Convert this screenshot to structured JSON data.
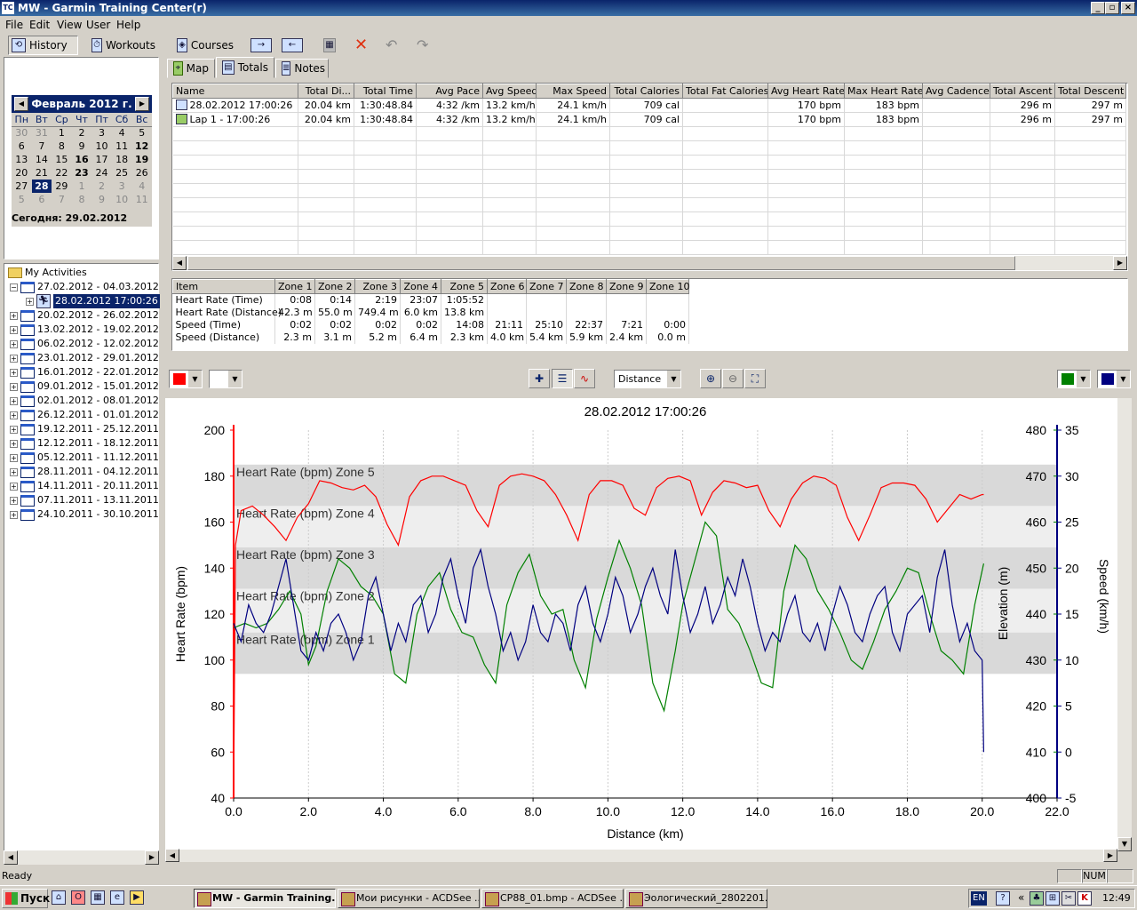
{
  "window": {
    "title": "MW - Garmin Training Center(r)",
    "app_icon_text": "TC",
    "minimize": "_",
    "maximize": "▫",
    "close": "×"
  },
  "menu": [
    "File",
    "Edit",
    "View",
    "User",
    "Help"
  ],
  "toolbar": {
    "history": "History",
    "workouts": "Workouts",
    "courses": "Courses"
  },
  "calendar": {
    "month_title": "Февраль 2012 г.",
    "prev": "◀",
    "next": "▶",
    "weekdays": [
      "Пн",
      "Вт",
      "Ср",
      "Чт",
      "Пт",
      "Сб",
      "Вс"
    ],
    "weeks": [
      [
        "30",
        "31",
        "1",
        "2",
        "3",
        "4",
        "5"
      ],
      [
        "6",
        "7",
        "8",
        "9",
        "10",
        "11",
        "12"
      ],
      [
        "13",
        "14",
        "15",
        "16",
        "17",
        "18",
        "19"
      ],
      [
        "20",
        "21",
        "22",
        "23",
        "24",
        "25",
        "26"
      ],
      [
        "27",
        "28",
        "29",
        "1",
        "2",
        "3",
        "4"
      ],
      [
        "5",
        "6",
        "7",
        "8",
        "9",
        "10",
        "11"
      ]
    ],
    "today_label": "Сегодня: 29.02.2012"
  },
  "tree": {
    "root": "My Activities",
    "items": [
      {
        "label": "27.02.2012 - 04.03.2012",
        "expanded": true
      },
      {
        "label": "28.02.2012 17:00:26",
        "child": true,
        "selected": true
      },
      {
        "label": "20.02.2012 - 26.02.2012"
      },
      {
        "label": "13.02.2012 - 19.02.2012"
      },
      {
        "label": "06.02.2012 - 12.02.2012"
      },
      {
        "label": "23.01.2012 - 29.01.2012"
      },
      {
        "label": "16.01.2012 - 22.01.2012"
      },
      {
        "label": "09.01.2012 - 15.01.2012"
      },
      {
        "label": "02.01.2012 - 08.01.2012"
      },
      {
        "label": "26.12.2011 - 01.01.2012"
      },
      {
        "label": "19.12.2011 - 25.12.2011"
      },
      {
        "label": "12.12.2011 - 18.12.2011"
      },
      {
        "label": "05.12.2011 - 11.12.2011"
      },
      {
        "label": "28.11.2011 - 04.12.2011"
      },
      {
        "label": "14.11.2011 - 20.11.2011"
      },
      {
        "label": "07.11.2011 - 13.11.2011"
      },
      {
        "label": "24.10.2011 - 30.10.2011"
      }
    ]
  },
  "tabs": {
    "map": "Map",
    "totals": "Totals",
    "notes": "Notes"
  },
  "totals": {
    "columns": [
      "Name",
      "Total Di...",
      "Total Time",
      "Avg Pace",
      "Avg Speed",
      "Max Speed",
      "Total Calories",
      "Total Fat Calories",
      "Avg Heart Rate",
      "Max Heart Rate",
      "Avg Cadence",
      "Total Ascent",
      "Total Descent"
    ],
    "rows": [
      [
        "28.02.2012 17:00:26",
        "20.04 km",
        "1:30:48.84",
        "4:32 /km",
        "13.2 km/h",
        "24.1 km/h",
        "709 cal",
        "",
        "170 bpm",
        "183 bpm",
        "",
        "296 m",
        "297 m"
      ],
      [
        "Lap 1 - 17:00:26",
        "20.04 km",
        "1:30:48.84",
        "4:32 /km",
        "13.2 km/h",
        "24.1 km/h",
        "709 cal",
        "",
        "170 bpm",
        "183 bpm",
        "",
        "296 m",
        "297 m"
      ]
    ]
  },
  "zones": {
    "columns": [
      "Item",
      "Zone 1",
      "Zone 2",
      "Zone 3",
      "Zone 4",
      "Zone 5",
      "Zone 6",
      "Zone 7",
      "Zone 8",
      "Zone 9",
      "Zone 10"
    ],
    "rows": [
      [
        "Heart Rate (Time)",
        "0:08",
        "0:14",
        "2:19",
        "23:07",
        "1:05:52",
        "",
        "",
        "",
        "",
        ""
      ],
      [
        "Heart Rate (Distance)",
        "42.3 m",
        "55.0 m",
        "749.4 m",
        "6.0 km",
        "13.8 km",
        "",
        "",
        "",
        "",
        ""
      ],
      [
        "Speed (Time)",
        "0:02",
        "0:02",
        "0:02",
        "0:02",
        "14:08",
        "21:11",
        "25:10",
        "22:37",
        "7:21",
        "0:00"
      ],
      [
        "Speed (Distance)",
        "2.3 m",
        "3.1 m",
        "5.2 m",
        "6.4 m",
        "2.3 km",
        "4.0 km",
        "5.4 km",
        "5.9 km",
        "2.4 km",
        "0.0 m"
      ]
    ]
  },
  "graph_toolbar": {
    "x_axis_select": "Distance",
    "left_color": "#ff0000",
    "right_color_1": "#008000",
    "right_color_2": "#000080"
  },
  "chart_data": {
    "type": "line",
    "title": "28.02.2012 17:00:26",
    "xlabel": "Distance (km)",
    "ylabel_left": "Heart Rate (bpm)",
    "ylabel_right_elev": "Elevation (m)",
    "ylabel_right_speed": "Speed (km/h)",
    "xlim": [
      0,
      22
    ],
    "xticks": [
      "0.0",
      "2.0",
      "4.0",
      "6.0",
      "8.0",
      "10.0",
      "12.0",
      "14.0",
      "16.0",
      "18.0",
      "20.0",
      "22.0"
    ],
    "hr_ylim": [
      40,
      200
    ],
    "hr_ticks": [
      "40",
      "60",
      "80",
      "100",
      "120",
      "140",
      "160",
      "180",
      "200"
    ],
    "elev_ylim": [
      400,
      480
    ],
    "elev_ticks": [
      "400",
      "410",
      "420",
      "430",
      "440",
      "450",
      "460",
      "470",
      "480"
    ],
    "speed_ylim": [
      -5,
      35
    ],
    "speed_ticks": [
      "-5",
      "0",
      "5",
      "10",
      "15",
      "20",
      "25",
      "30",
      "35"
    ],
    "zones": [
      {
        "name": "Heart Rate (bpm) Zone 5",
        "min": 167,
        "max": 185
      },
      {
        "name": "Heart Rate (bpm) Zone 4",
        "min": 149,
        "max": 167
      },
      {
        "name": "Heart Rate (bpm) Zone 3",
        "min": 131,
        "max": 149
      },
      {
        "name": "Heart Rate (bpm) Zone 2",
        "min": 112,
        "max": 131
      },
      {
        "name": "Heart Rate (bpm) Zone 1",
        "min": 94,
        "max": 112
      }
    ],
    "series": [
      {
        "name": "Heart Rate",
        "color": "#ff0000",
        "x": [
          0,
          0.05,
          0.2,
          0.5,
          0.8,
          1.1,
          1.4,
          1.7,
          2.0,
          2.3,
          2.6,
          2.9,
          3.2,
          3.5,
          3.8,
          4.1,
          4.4,
          4.7,
          5.0,
          5.3,
          5.6,
          5.9,
          6.2,
          6.5,
          6.8,
          7.1,
          7.4,
          7.7,
          8.0,
          8.3,
          8.6,
          8.9,
          9.2,
          9.5,
          9.8,
          10.1,
          10.4,
          10.7,
          11.0,
          11.3,
          11.6,
          11.9,
          12.2,
          12.5,
          12.8,
          13.1,
          13.4,
          13.7,
          14.0,
          14.3,
          14.6,
          14.9,
          15.2,
          15.5,
          15.8,
          16.1,
          16.4,
          16.7,
          17.0,
          17.3,
          17.6,
          17.9,
          18.2,
          18.5,
          18.8,
          19.1,
          19.4,
          19.7,
          20.0,
          20.04
        ],
        "values": [
          40,
          150,
          165,
          167,
          163,
          158,
          152,
          162,
          168,
          178,
          177,
          175,
          174,
          176,
          171,
          159,
          150,
          171,
          178,
          180,
          180,
          178,
          176,
          165,
          158,
          176,
          180,
          181,
          180,
          178,
          172,
          163,
          152,
          172,
          178,
          178,
          176,
          166,
          163,
          175,
          179,
          180,
          178,
          163,
          173,
          178,
          177,
          175,
          176,
          165,
          158,
          170,
          177,
          180,
          179,
          176,
          162,
          152,
          163,
          175,
          177,
          177,
          176,
          170,
          160,
          166,
          172,
          170,
          172,
          172
        ]
      },
      {
        "name": "Elevation",
        "color": "#008000",
        "x": [
          0,
          0.3,
          0.6,
          0.9,
          1.2,
          1.5,
          1.8,
          2.0,
          2.2,
          2.5,
          2.8,
          3.1,
          3.4,
          3.7,
          4.0,
          4.3,
          4.6,
          4.9,
          5.2,
          5.5,
          5.8,
          6.1,
          6.4,
          6.7,
          7.0,
          7.3,
          7.6,
          7.9,
          8.2,
          8.5,
          8.8,
          9.1,
          9.4,
          9.7,
          10.0,
          10.3,
          10.6,
          10.9,
          11.2,
          11.5,
          11.8,
          12.0,
          12.3,
          12.6,
          12.9,
          13.2,
          13.5,
          13.8,
          14.1,
          14.4,
          14.7,
          15.0,
          15.3,
          15.6,
          15.9,
          16.2,
          16.5,
          16.8,
          17.1,
          17.4,
          17.7,
          18.0,
          18.3,
          18.6,
          18.9,
          19.2,
          19.5,
          19.8,
          20.04
        ],
        "values": [
          437,
          438,
          437,
          438,
          441,
          445,
          440,
          429,
          433,
          445,
          452,
          450,
          446,
          444,
          440,
          427,
          425,
          440,
          446,
          449,
          441,
          436,
          435,
          429,
          425,
          442,
          449,
          453,
          444,
          440,
          441,
          430,
          424,
          439,
          448,
          456,
          450,
          442,
          425,
          419,
          432,
          442,
          451,
          460,
          457,
          441,
          438,
          432,
          425,
          424,
          445,
          455,
          452,
          445,
          441,
          436,
          430,
          428,
          434,
          441,
          445,
          450,
          449,
          440,
          432,
          430,
          427,
          442,
          451
        ]
      },
      {
        "name": "Speed",
        "color": "#000080",
        "x": [
          0,
          0.2,
          0.4,
          0.6,
          0.8,
          1.0,
          1.2,
          1.4,
          1.6,
          1.8,
          2.0,
          2.2,
          2.4,
          2.6,
          2.8,
          3.0,
          3.2,
          3.4,
          3.6,
          3.8,
          4.0,
          4.2,
          4.4,
          4.6,
          4.8,
          5.0,
          5.2,
          5.4,
          5.6,
          5.8,
          6.0,
          6.2,
          6.4,
          6.6,
          6.8,
          7.0,
          7.2,
          7.4,
          7.6,
          7.8,
          8.0,
          8.2,
          8.4,
          8.6,
          8.8,
          9.0,
          9.2,
          9.4,
          9.6,
          9.8,
          10.0,
          10.2,
          10.4,
          10.6,
          10.8,
          11.0,
          11.2,
          11.4,
          11.6,
          11.8,
          12.0,
          12.2,
          12.4,
          12.6,
          12.8,
          13.0,
          13.2,
          13.4,
          13.6,
          13.8,
          14.0,
          14.2,
          14.4,
          14.6,
          14.8,
          15.0,
          15.2,
          15.4,
          15.6,
          15.8,
          16.0,
          16.2,
          16.4,
          16.6,
          16.8,
          17.0,
          17.2,
          17.4,
          17.6,
          17.8,
          18.0,
          18.2,
          18.4,
          18.6,
          18.8,
          19.0,
          19.2,
          19.4,
          19.6,
          19.8,
          20.0,
          20.04
        ],
        "values": [
          14,
          12,
          16,
          14,
          13,
          15,
          18,
          21,
          16,
          11,
          10,
          13,
          11,
          14,
          15,
          13,
          10,
          12,
          17,
          19,
          15,
          11,
          14,
          12,
          16,
          17,
          13,
          15,
          19,
          21,
          17,
          14,
          20,
          22,
          18,
          15,
          11,
          13,
          10,
          12,
          16,
          13,
          12,
          15,
          14,
          11,
          16,
          18,
          14,
          12,
          15,
          19,
          17,
          13,
          15,
          18,
          20,
          17,
          15,
          22,
          17,
          13,
          15,
          18,
          14,
          16,
          19,
          17,
          21,
          18,
          14,
          11,
          13,
          12,
          15,
          17,
          13,
          12,
          14,
          11,
          15,
          18,
          16,
          13,
          12,
          15,
          17,
          18,
          13,
          11,
          15,
          16,
          17,
          13,
          19,
          22,
          16,
          12,
          14,
          11,
          10,
          0
        ]
      }
    ]
  },
  "status": {
    "left": "Ready",
    "num": "NUM"
  },
  "taskbar": {
    "start": "Пуск",
    "tasks": [
      "MW - Garmin Training...",
      "Мои рисунки - ACDSee ...",
      "CP88_01.bmp - ACDSee ...",
      "Эологический_2802201..."
    ],
    "lang": "EN",
    "clock": "12:49"
  }
}
